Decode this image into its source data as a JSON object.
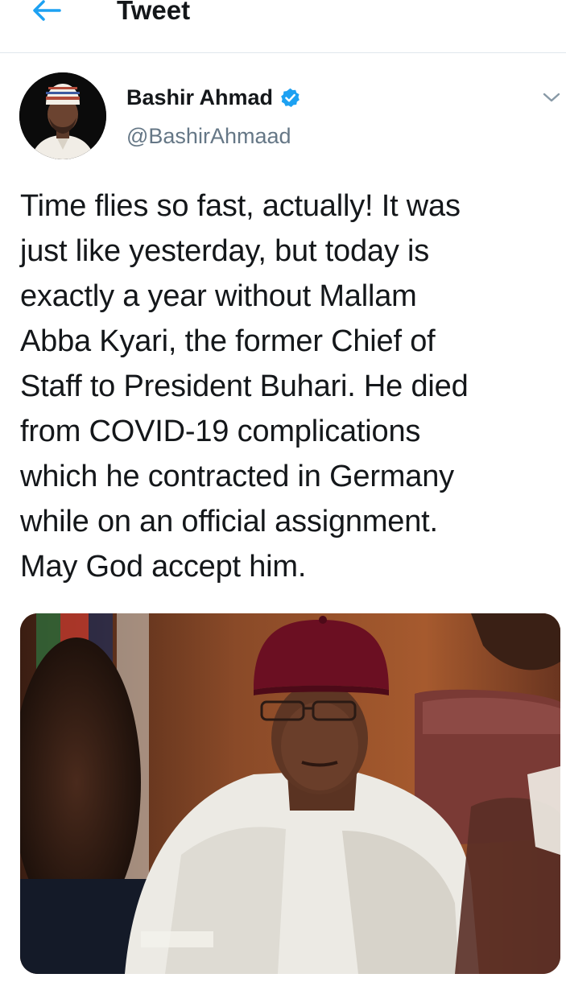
{
  "header": {
    "title": "Tweet",
    "back_icon": "arrow-left-icon",
    "accent_color": "#1da1f2"
  },
  "author": {
    "name": "Bashir Ahmad",
    "handle": "@BashirAhmaad",
    "verified": true,
    "verified_icon": "verified-badge-icon",
    "avatar_icon": "avatar"
  },
  "tweet": {
    "text": "Time flies so fast, actually! It was\njust like yesterday, but today is\nexactly a year without Mallam\nAbba Kyari, the former Chief of\nStaff to President Buhari. He died\nfrom COVID-19 complications\nwhich he contracted in Germany\nwhile on an official assignment.\nMay God accept him.",
    "menu_icon": "chevron-down-icon"
  },
  "media": {
    "kind": "photo"
  }
}
